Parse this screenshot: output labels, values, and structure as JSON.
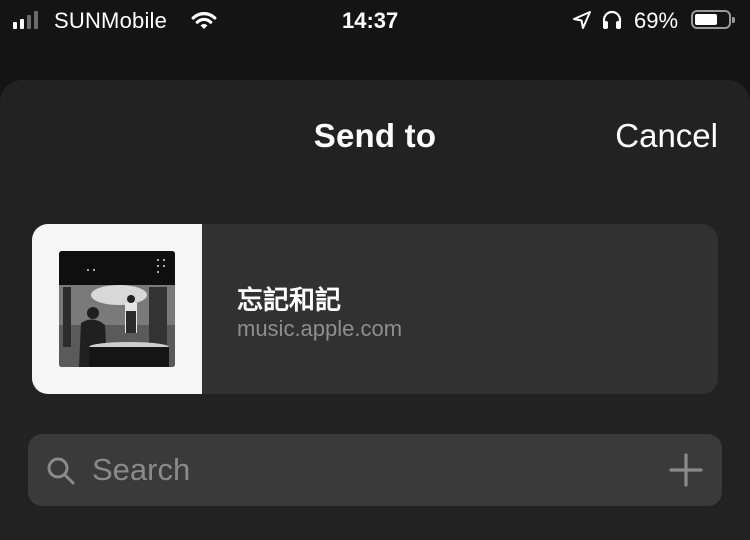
{
  "status_bar": {
    "carrier": "SUNMobile",
    "time": "14:37",
    "battery_percent": "69%",
    "battery_level": 0.69,
    "signal_bars_active": 2,
    "signal_bars_total": 4,
    "icons": [
      "wifi-icon",
      "location-arrow-icon",
      "headphones-icon",
      "battery-icon"
    ]
  },
  "sheet": {
    "title": "Send to",
    "cancel_label": "Cancel"
  },
  "share_item": {
    "title": "忘記和記",
    "url": "music.apple.com",
    "thumbnail": "album-artwork-image"
  },
  "search": {
    "placeholder": "Search",
    "icons": [
      "search-icon",
      "plus-icon"
    ]
  },
  "colors": {
    "background": "#141414",
    "sheet": "#222222",
    "card": "#313131",
    "search_field": "#3a3a3a",
    "secondary_text": "#8e8e8e"
  }
}
